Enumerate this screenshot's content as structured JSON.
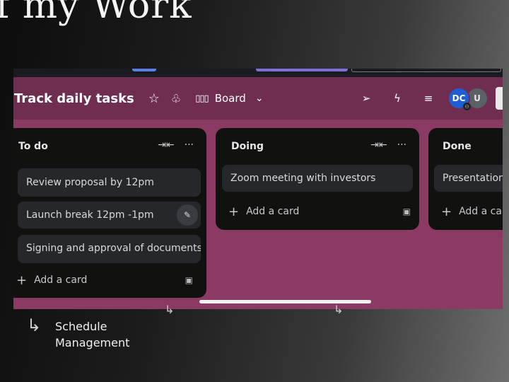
{
  "hero": {
    "title": "f  my Work"
  },
  "board": {
    "title": "Track daily tasks",
    "view_label": "Board",
    "avatars": [
      {
        "initials": "DC",
        "color": "#1f5fd6"
      },
      {
        "initials": "U",
        "color": "#5b5f66"
      }
    ],
    "lists": [
      {
        "title": "To do",
        "cards": [
          "Review proposal by 12pm",
          "Launch break 12pm -1pm",
          "Signing and approval of documents"
        ],
        "add_label": "Add a card"
      },
      {
        "title": "Doing",
        "cards": [
          "Zoom meeting with investors"
        ],
        "add_label": "Add a card"
      },
      {
        "title": "Done",
        "cards": [
          "Presentation"
        ],
        "add_label": "Add a card"
      }
    ]
  },
  "caption": {
    "line1": "Schedule",
    "line2": "Management"
  },
  "colors": {
    "board_bg": "#8a3a63",
    "header_bg": "#6f2e50",
    "list_bg": "#111210",
    "card_bg": "#25272b"
  },
  "icons": [
    "star-icon",
    "people-icon",
    "board-view-icon",
    "chevron-down-icon",
    "send-icon",
    "bolt-icon",
    "filter-icon",
    "collapse-icon",
    "more-icon",
    "plus-icon",
    "template-icon",
    "edit-icon",
    "arrow-icon"
  ]
}
